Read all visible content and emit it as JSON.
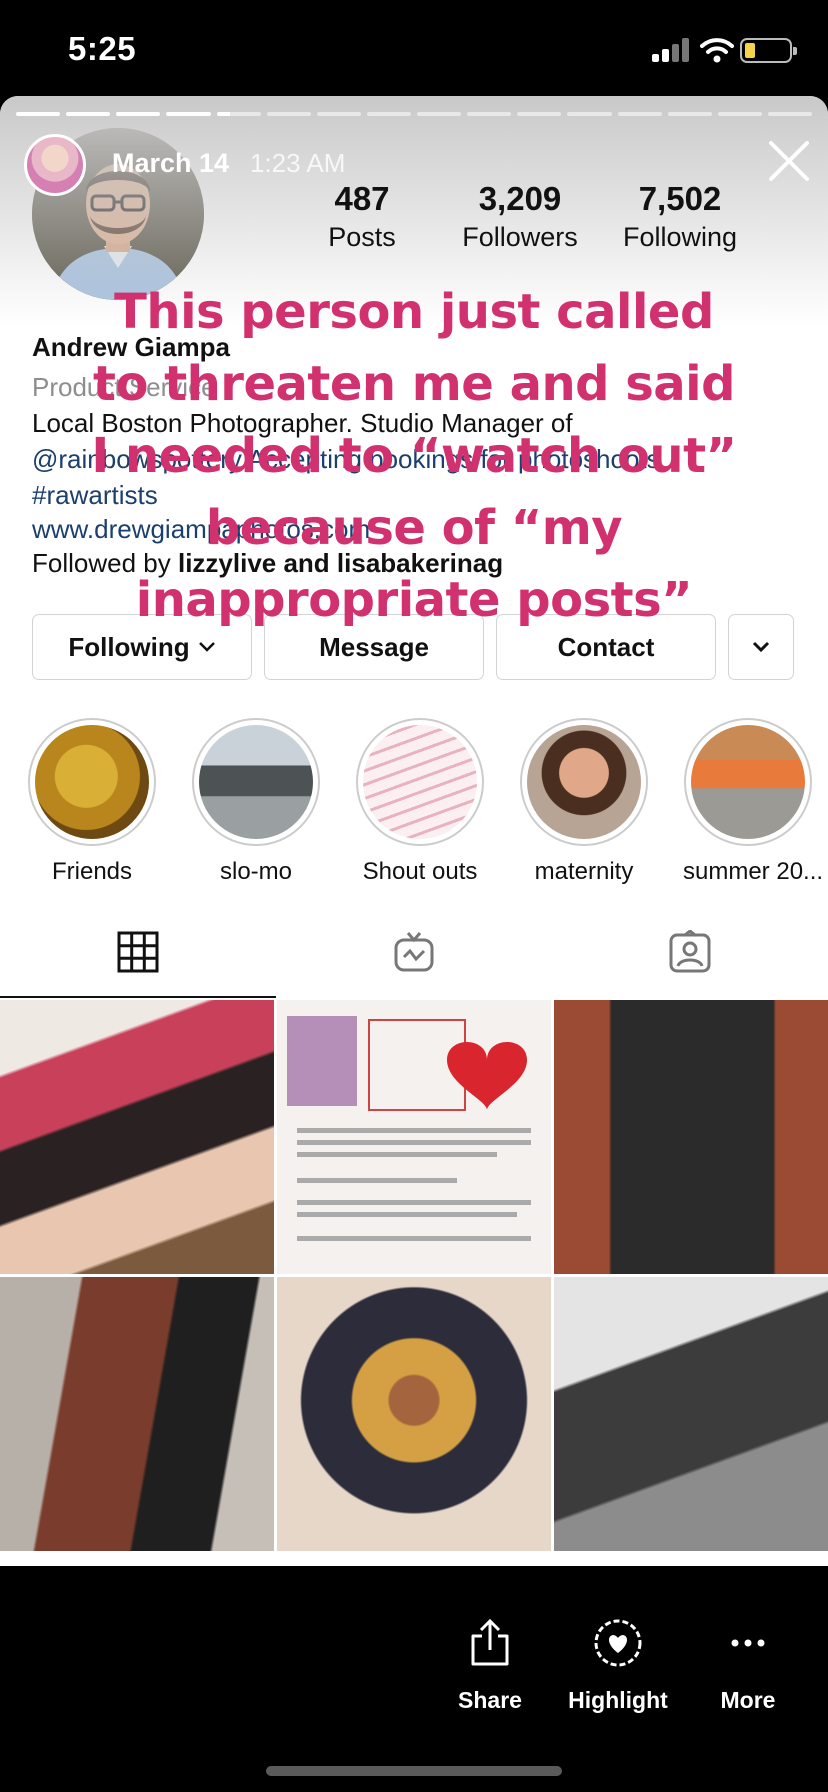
{
  "status_bar": {
    "time": "5:25"
  },
  "story": {
    "date": "March 14",
    "time": "1:23 AM",
    "overlay_text": "This person just called\nto threaten me and said\nI needed to “watch out”\nbecause of “my\ninappropriate posts”"
  },
  "profile": {
    "name": "Andrew Giampa",
    "category": "Product/Service",
    "bio_line1": "Local Boston Photographer. Studio Manager of",
    "bio_line2": "@rainbowspottery Accepting bookings for photoshoots",
    "bio_line3": "#rawartists",
    "website": "www.drewgiampaphotos.com",
    "followed_by_prefix": "Followed by ",
    "followed_by_names": "lizzylive and lisabakerinag",
    "stats": [
      {
        "value": "487",
        "label": "Posts"
      },
      {
        "value": "3,209",
        "label": "Followers"
      },
      {
        "value": "7,502",
        "label": "Following"
      }
    ]
  },
  "buttons": {
    "following": "Following",
    "message": "Message",
    "contact": "Contact"
  },
  "highlights": [
    {
      "label": "Friends"
    },
    {
      "label": "slo-mo"
    },
    {
      "label": "Shout outs"
    },
    {
      "label": "maternity"
    },
    {
      "label": "summer 20..."
    }
  ],
  "bottom_bar": {
    "share": "Share",
    "highlight": "Highlight",
    "more": "More"
  },
  "colors": {
    "overlay_text": "#d1316f",
    "link": "#1c3f6e"
  }
}
